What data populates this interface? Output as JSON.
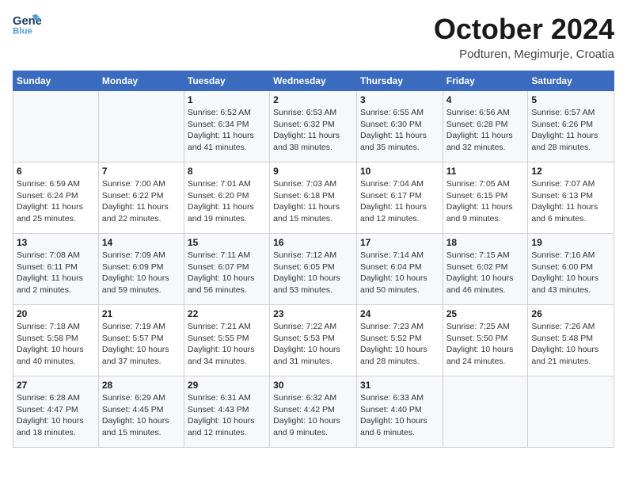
{
  "header": {
    "logo_line1": "General",
    "logo_line2": "Blue",
    "month": "October 2024",
    "location": "Podturen, Megimurje, Croatia"
  },
  "weekdays": [
    "Sunday",
    "Monday",
    "Tuesday",
    "Wednesday",
    "Thursday",
    "Friday",
    "Saturday"
  ],
  "weeks": [
    [
      {
        "day": "",
        "info": ""
      },
      {
        "day": "",
        "info": ""
      },
      {
        "day": "1",
        "info": "Sunrise: 6:52 AM\nSunset: 6:34 PM\nDaylight: 11 hours and 41 minutes."
      },
      {
        "day": "2",
        "info": "Sunrise: 6:53 AM\nSunset: 6:32 PM\nDaylight: 11 hours and 38 minutes."
      },
      {
        "day": "3",
        "info": "Sunrise: 6:55 AM\nSunset: 6:30 PM\nDaylight: 11 hours and 35 minutes."
      },
      {
        "day": "4",
        "info": "Sunrise: 6:56 AM\nSunset: 6:28 PM\nDaylight: 11 hours and 32 minutes."
      },
      {
        "day": "5",
        "info": "Sunrise: 6:57 AM\nSunset: 6:26 PM\nDaylight: 11 hours and 28 minutes."
      }
    ],
    [
      {
        "day": "6",
        "info": "Sunrise: 6:59 AM\nSunset: 6:24 PM\nDaylight: 11 hours and 25 minutes."
      },
      {
        "day": "7",
        "info": "Sunrise: 7:00 AM\nSunset: 6:22 PM\nDaylight: 11 hours and 22 minutes."
      },
      {
        "day": "8",
        "info": "Sunrise: 7:01 AM\nSunset: 6:20 PM\nDaylight: 11 hours and 19 minutes."
      },
      {
        "day": "9",
        "info": "Sunrise: 7:03 AM\nSunset: 6:18 PM\nDaylight: 11 hours and 15 minutes."
      },
      {
        "day": "10",
        "info": "Sunrise: 7:04 AM\nSunset: 6:17 PM\nDaylight: 11 hours and 12 minutes."
      },
      {
        "day": "11",
        "info": "Sunrise: 7:05 AM\nSunset: 6:15 PM\nDaylight: 11 hours and 9 minutes."
      },
      {
        "day": "12",
        "info": "Sunrise: 7:07 AM\nSunset: 6:13 PM\nDaylight: 11 hours and 6 minutes."
      }
    ],
    [
      {
        "day": "13",
        "info": "Sunrise: 7:08 AM\nSunset: 6:11 PM\nDaylight: 11 hours and 2 minutes."
      },
      {
        "day": "14",
        "info": "Sunrise: 7:09 AM\nSunset: 6:09 PM\nDaylight: 10 hours and 59 minutes."
      },
      {
        "day": "15",
        "info": "Sunrise: 7:11 AM\nSunset: 6:07 PM\nDaylight: 10 hours and 56 minutes."
      },
      {
        "day": "16",
        "info": "Sunrise: 7:12 AM\nSunset: 6:05 PM\nDaylight: 10 hours and 53 minutes."
      },
      {
        "day": "17",
        "info": "Sunrise: 7:14 AM\nSunset: 6:04 PM\nDaylight: 10 hours and 50 minutes."
      },
      {
        "day": "18",
        "info": "Sunrise: 7:15 AM\nSunset: 6:02 PM\nDaylight: 10 hours and 46 minutes."
      },
      {
        "day": "19",
        "info": "Sunrise: 7:16 AM\nSunset: 6:00 PM\nDaylight: 10 hours and 43 minutes."
      }
    ],
    [
      {
        "day": "20",
        "info": "Sunrise: 7:18 AM\nSunset: 5:58 PM\nDaylight: 10 hours and 40 minutes."
      },
      {
        "day": "21",
        "info": "Sunrise: 7:19 AM\nSunset: 5:57 PM\nDaylight: 10 hours and 37 minutes."
      },
      {
        "day": "22",
        "info": "Sunrise: 7:21 AM\nSunset: 5:55 PM\nDaylight: 10 hours and 34 minutes."
      },
      {
        "day": "23",
        "info": "Sunrise: 7:22 AM\nSunset: 5:53 PM\nDaylight: 10 hours and 31 minutes."
      },
      {
        "day": "24",
        "info": "Sunrise: 7:23 AM\nSunset: 5:52 PM\nDaylight: 10 hours and 28 minutes."
      },
      {
        "day": "25",
        "info": "Sunrise: 7:25 AM\nSunset: 5:50 PM\nDaylight: 10 hours and 24 minutes."
      },
      {
        "day": "26",
        "info": "Sunrise: 7:26 AM\nSunset: 5:48 PM\nDaylight: 10 hours and 21 minutes."
      }
    ],
    [
      {
        "day": "27",
        "info": "Sunrise: 6:28 AM\nSunset: 4:47 PM\nDaylight: 10 hours and 18 minutes."
      },
      {
        "day": "28",
        "info": "Sunrise: 6:29 AM\nSunset: 4:45 PM\nDaylight: 10 hours and 15 minutes."
      },
      {
        "day": "29",
        "info": "Sunrise: 6:31 AM\nSunset: 4:43 PM\nDaylight: 10 hours and 12 minutes."
      },
      {
        "day": "30",
        "info": "Sunrise: 6:32 AM\nSunset: 4:42 PM\nDaylight: 10 hours and 9 minutes."
      },
      {
        "day": "31",
        "info": "Sunrise: 6:33 AM\nSunset: 4:40 PM\nDaylight: 10 hours and 6 minutes."
      },
      {
        "day": "",
        "info": ""
      },
      {
        "day": "",
        "info": ""
      }
    ]
  ]
}
